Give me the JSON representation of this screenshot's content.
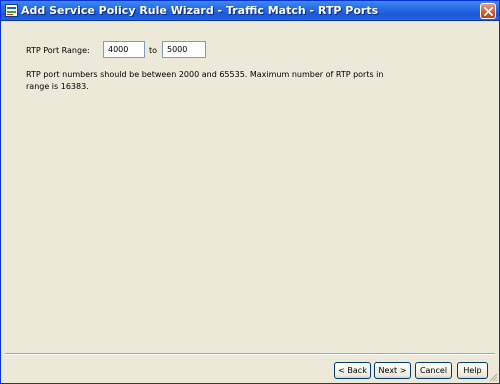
{
  "window": {
    "title": "Add Service Policy Rule Wizard - Traffic Match - RTP Ports"
  },
  "rtp": {
    "range_label": "RTP Port Range:",
    "start_value": "4000",
    "to_label": "to",
    "end_value": "5000",
    "info_text": "RTP port numbers should be between 2000 and 65535. Maximum number of RTP ports in range is 16383."
  },
  "buttons": {
    "back": "< Back",
    "next": "Next >",
    "cancel": "Cancel",
    "help": "Help"
  },
  "icons": {
    "app": "asdm-app-icon",
    "close": "close-icon"
  },
  "colors": {
    "titlebar": "#2a6ee8",
    "background": "#ece9d8",
    "close_button": "#d2582e"
  }
}
